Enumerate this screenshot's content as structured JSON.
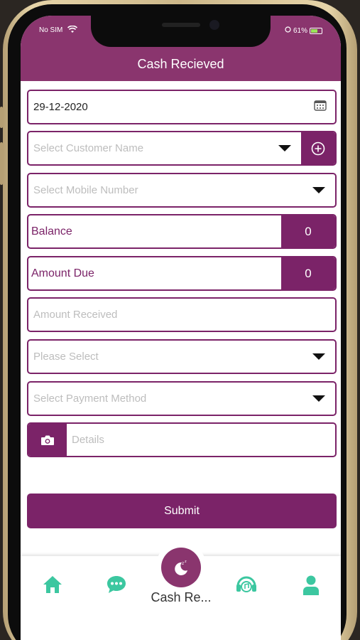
{
  "status": {
    "carrier": "No SIM",
    "battery": "61%"
  },
  "header": {
    "title": "Cash Recieved"
  },
  "form": {
    "date_value": "29-12-2020",
    "customer_placeholder": "Select Customer Name",
    "mobile_placeholder": "Select Mobile Number",
    "balance_label": "Balance",
    "balance_value": "0",
    "amount_due_label": "Amount Due",
    "amount_due_value": "0",
    "amount_received_placeholder": "Amount Received",
    "please_select_placeholder": "Please Select",
    "payment_method_placeholder": "Select Payment Method",
    "details_placeholder": "Details",
    "submit_label": "Submit"
  },
  "tabbar": {
    "active_label": "Cash Re...",
    "icons": [
      "home-icon",
      "chat-icon",
      "moon-icon",
      "support-icon",
      "user-icon"
    ]
  },
  "colors": {
    "brand": "#7b2368",
    "header": "#8a356e",
    "tab_icon": "#3cc7a0"
  }
}
